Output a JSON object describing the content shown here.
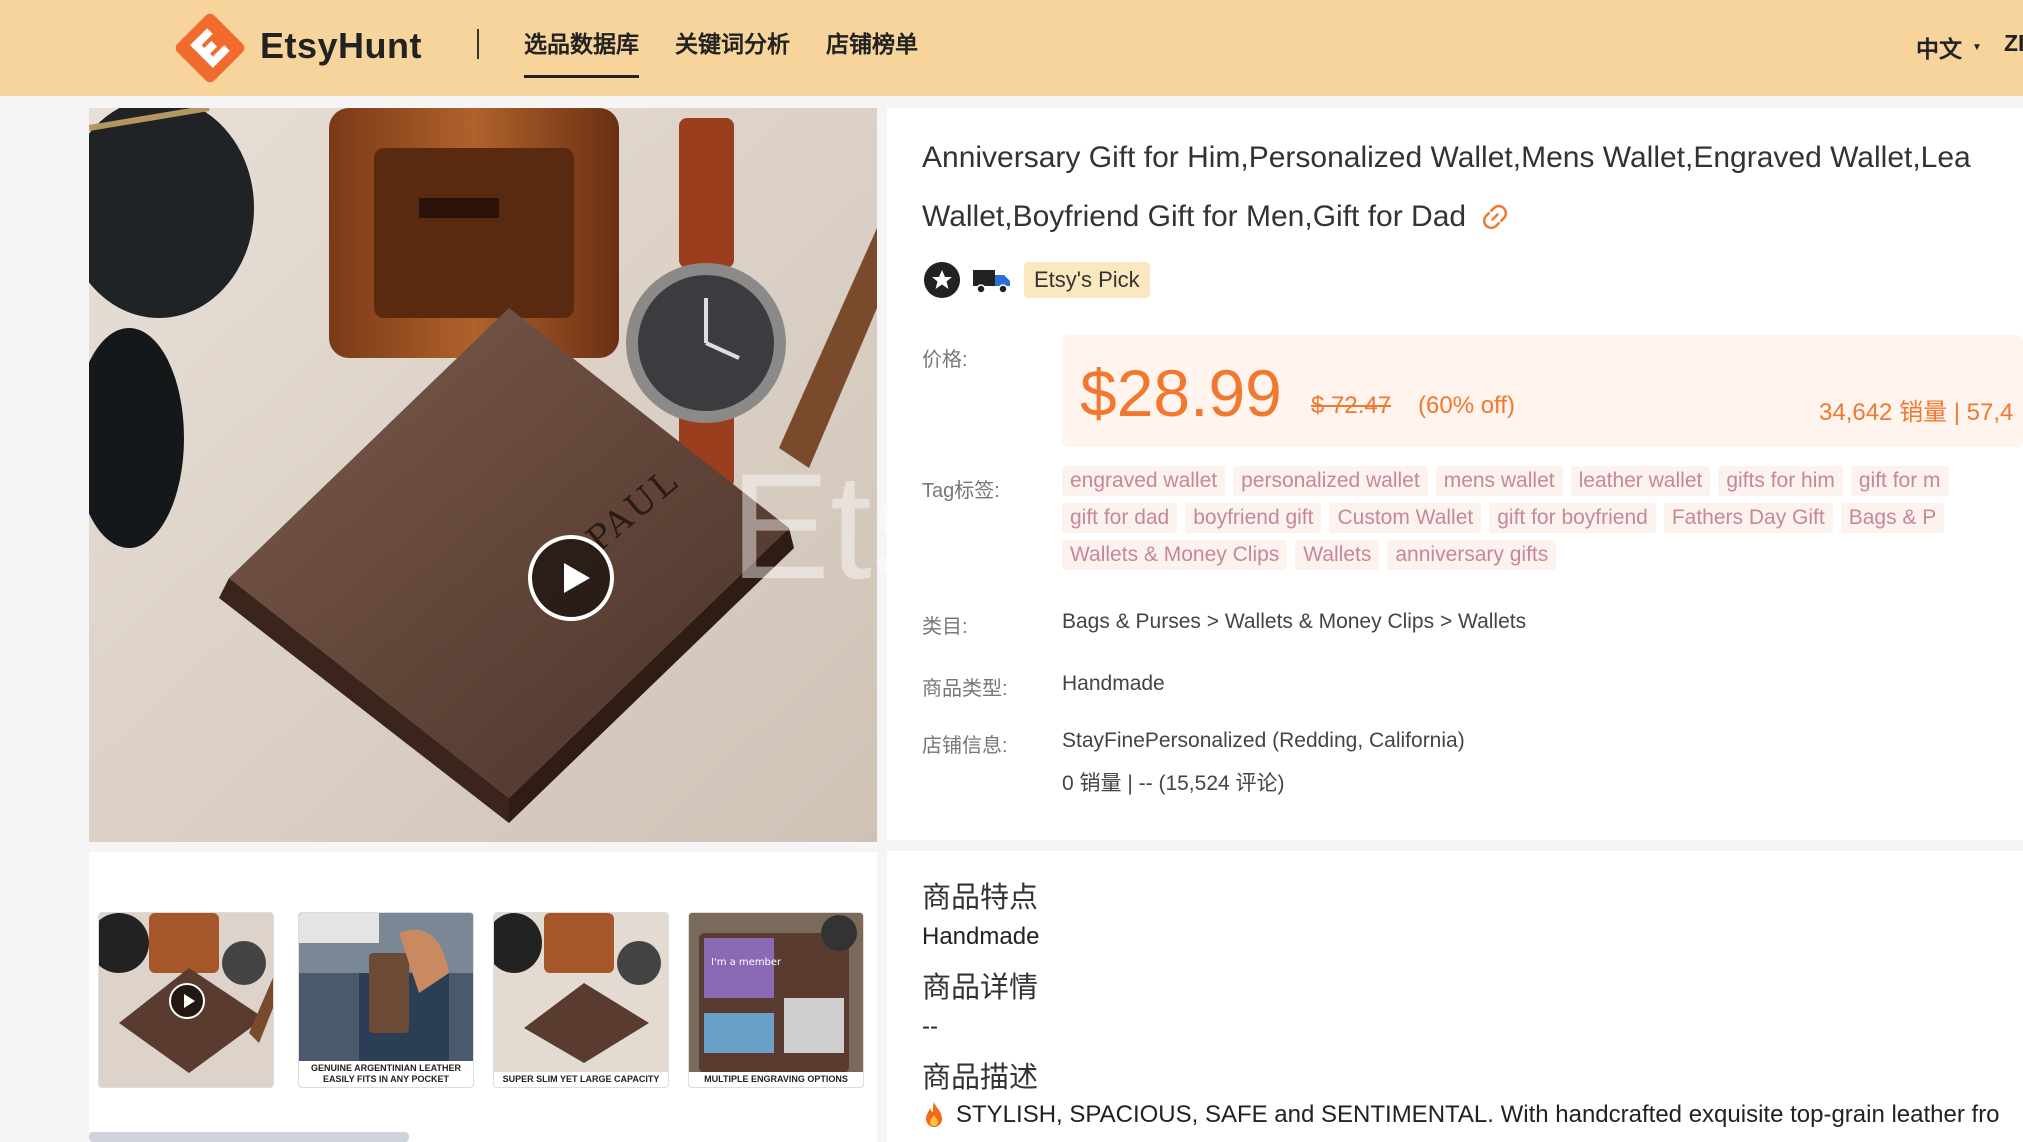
{
  "header": {
    "brand": "EtsyHunt",
    "nav": [
      "选品数据库",
      "关键词分析",
      "店铺榜单"
    ],
    "language": "中文",
    "user_initial": "ZI"
  },
  "media": {
    "watermark": "EtsyHunt",
    "thumbnails": [
      {
        "caption": ""
      },
      {
        "caption": "GENUINE ARGENTINIAN LEATHER EASILY FITS IN ANY POCKET"
      },
      {
        "caption": "SUPER SLIM YET LARGE CAPACITY"
      },
      {
        "caption": "MULTIPLE ENGRAVING OPTIONS"
      }
    ],
    "thumb4_card_text": "I'm a member"
  },
  "product": {
    "title_line1": "Anniversary Gift for Him,Personalized Wallet,Mens Wallet,Engraved Wallet,Lea",
    "title_line2": "Wallet,Boyfriend Gift for Men,Gift for Dad",
    "badge": "Etsy's Pick",
    "price_label": "价格:",
    "price": "$28.99",
    "old_price": "$ 72.47",
    "discount": "(60% off)",
    "sales_stats": "34,642 销量 | 57,4",
    "tags_label": "Tag标签:",
    "tags_row1": [
      "engraved wallet",
      "personalized wallet",
      "mens wallet",
      "leather wallet",
      "gifts for him",
      "gift for m"
    ],
    "tags_row2": [
      "gift for dad",
      "boyfriend gift",
      "Custom Wallet",
      "gift for boyfriend",
      "Fathers Day Gift",
      "Bags & P"
    ],
    "tags_row3": [
      "Wallets & Money Clips",
      "Wallets",
      "anniversary gifts"
    ],
    "category_label": "类目:",
    "category": "Bags & Purses  > Wallets & Money Clips > Wallets",
    "type_label": "商品类型:",
    "type": "Handmade",
    "shop_label": "店铺信息:",
    "shop": "StayFinePersonalized (Redding, California)",
    "shop_stats": "0 销量 | -- (15,524 评论)"
  },
  "details": {
    "features_title": "商品特点",
    "features": "Handmade",
    "detail_title": "商品详情",
    "detail": "--",
    "description_title": "商品描述",
    "description": "STYLISH, SPACIOUS, SAFE and SENTIMENTAL. With handcrafted exquisite top-grain leather fro"
  },
  "colors": {
    "header_bg": "#f7d49c",
    "price": "#f2772f",
    "logo": "#f26a2e"
  }
}
